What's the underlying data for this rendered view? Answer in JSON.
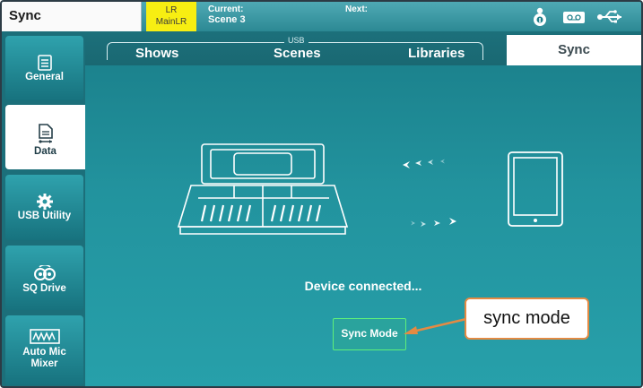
{
  "topbar": {
    "title": "Sync",
    "lr_line1": "LR",
    "lr_line2": "MainLR",
    "current_label": "Current:",
    "current_value": "Scene 3",
    "next_label": "Next:",
    "icons": [
      "user-key-icon",
      "tape-icon",
      "usb-icon"
    ]
  },
  "sidebar": {
    "items": [
      {
        "label": "General",
        "icon": "menu-list-icon"
      },
      {
        "label": "Data",
        "icon": "file-usb-icon"
      },
      {
        "label": "USB Utility",
        "icon": "gear-icon"
      },
      {
        "label": "SQ Drive",
        "icon": "drive-icon"
      },
      {
        "label": "Auto Mic Mixer",
        "icon": "mixer-wave-icon",
        "label_line1": "Auto Mic",
        "label_line2": "Mixer"
      }
    ],
    "active": "Data"
  },
  "tabs": {
    "group_label": "USB",
    "shows": "Shows",
    "scenes": "Scenes",
    "libraries": "Libraries",
    "sync": "Sync",
    "active": "Sync"
  },
  "main": {
    "status": "Device connected...",
    "sync_button": "Sync Mode"
  },
  "annotation": {
    "callout_text": "sync mode",
    "accent_color": "#e48a43"
  },
  "colors": {
    "background_teal": "#1f8c97",
    "lr_yellow": "#f7ee12",
    "button_border_green": "#5ff07a"
  }
}
